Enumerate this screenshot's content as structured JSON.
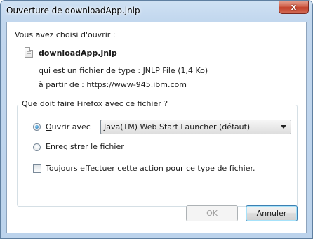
{
  "window": {
    "title": "Ouverture de downloadApp.jnlp",
    "close_glyph": "x"
  },
  "intro": {
    "text": "Vous avez choisi d'ouvrir :"
  },
  "file": {
    "icon": "file-icon",
    "name": "downloadApp.jnlp",
    "type_line": "qui est un fichier de type :  JNLP File (1,4 Ko)",
    "source_line": "à partir de :  https://www-945.ibm.com"
  },
  "group": {
    "legend": "Que doit faire Firefox avec ce fichier ?",
    "open_with": {
      "accesskey": "O",
      "rest": "uvrir avec",
      "selected": true
    },
    "app_select": {
      "value": "Java(TM) Web Start Launcher (défaut)"
    },
    "save": {
      "accesskey": "E",
      "rest": "nregistrer le fichier",
      "selected": false
    },
    "always": {
      "accesskey": "T",
      "rest": "oujours effectuer cette action pour ce type de fichier.",
      "checked": false
    }
  },
  "buttons": {
    "ok": "OK",
    "cancel": "Annuler"
  }
}
